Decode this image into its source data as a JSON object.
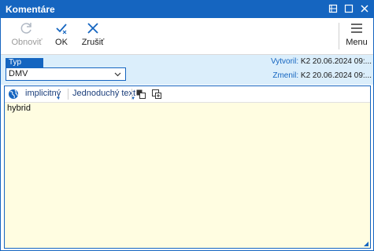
{
  "window": {
    "title": "Komentáre",
    "controls": [
      "restore-icon",
      "maximize-icon",
      "close-icon"
    ]
  },
  "toolbar": {
    "refresh_label": "Obnoviť",
    "ok_label": "OK",
    "cancel_label": "Zrušiť",
    "menu_label": "Menu"
  },
  "type_field": {
    "label": "Typ",
    "value": "DMV"
  },
  "meta": {
    "created_label": "Vytvoril:",
    "created_value": "K2 20.06.2024 09:...",
    "modified_label": "Zmenil:",
    "modified_value": "K2 20.06.2024 09:..."
  },
  "editor": {
    "language_label": "implicitný",
    "format_label": "Jednoduchý text",
    "content": "hybrid"
  },
  "colors": {
    "accent": "#1565c0",
    "info_background": "#dbeefb",
    "editor_background": "#fffde1"
  }
}
